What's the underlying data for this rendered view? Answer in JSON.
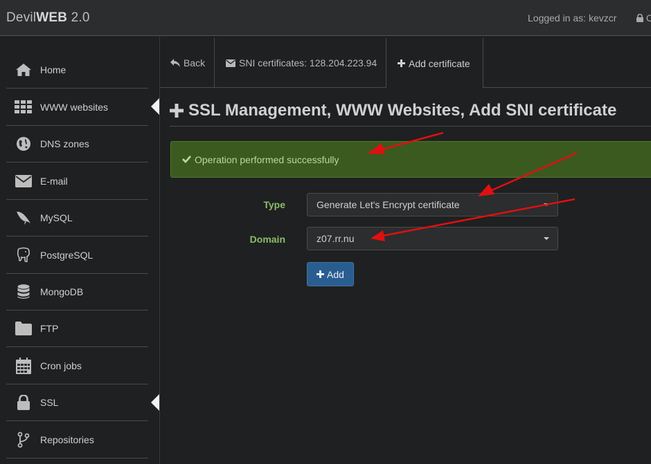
{
  "app": {
    "brand_prefix": "Devil",
    "brand_bold": "WEB",
    "brand_version": " 2.0"
  },
  "header": {
    "logged_in": "Logged in as: kevzcr",
    "logout_partial": "C"
  },
  "sidebar": {
    "items": [
      {
        "label": "Home",
        "icon": "home-icon"
      },
      {
        "label": "WWW websites",
        "icon": "grid-icon",
        "active": true
      },
      {
        "label": "DNS zones",
        "icon": "globe-icon"
      },
      {
        "label": "E-mail",
        "icon": "envelope-icon"
      },
      {
        "label": "MySQL",
        "icon": "dolphin-icon"
      },
      {
        "label": "PostgreSQL",
        "icon": "elephant-icon"
      },
      {
        "label": "MongoDB",
        "icon": "database-icon"
      },
      {
        "label": "FTP",
        "icon": "folder-icon"
      },
      {
        "label": "Cron jobs",
        "icon": "calendar-icon"
      },
      {
        "label": "SSL",
        "icon": "lock-icon",
        "active": true
      },
      {
        "label": "Repositories",
        "icon": "branch-icon"
      }
    ]
  },
  "tabs": {
    "back": "Back",
    "sni": "SNI certificates: 128.204.223.94",
    "add": "Add certificate"
  },
  "page": {
    "title": "SSL Management, WWW Websites, Add SNI certificate"
  },
  "alert": {
    "text": "Operation performed successfully"
  },
  "form": {
    "type_label": "Type",
    "type_value": "Generate Let's Encrypt certificate",
    "domain_label": "Domain",
    "domain_value": "z07.rr.nu",
    "submit": "Add"
  },
  "colors": {
    "background": "#1f2021",
    "success_bg": "#3b5a1f",
    "label_green": "#8cbd6a",
    "primary_button": "#2a5d8f",
    "annotation_arrow": "#e01010"
  }
}
